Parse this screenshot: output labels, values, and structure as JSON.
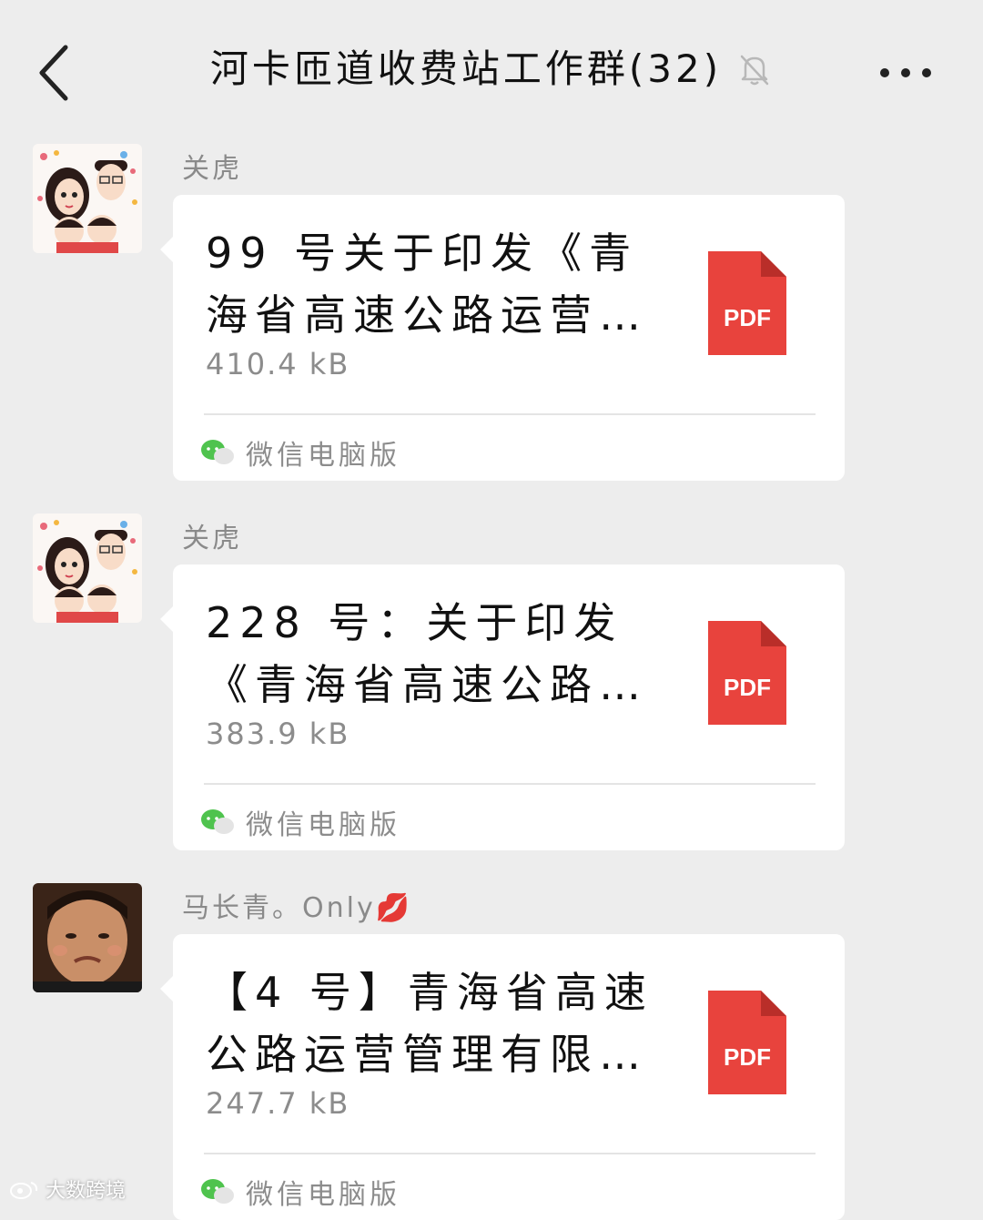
{
  "header": {
    "title": "河卡匝道收费站工作群(32)",
    "back_icon": "chevron-left-icon",
    "mute_icon": "bell-off-icon",
    "more_icon": "more-horizontal-icon"
  },
  "messages": [
    {
      "sender": "关虎",
      "file_name": "99 号关于印发《青海省高速公路运营管…",
      "file_size": "410.4 kB",
      "file_type": "PDF",
      "source": "微信电脑版"
    },
    {
      "sender": "关虎",
      "file_name": "228 号：关于印发《青海省高速公路运营…",
      "file_size": "383.9 kB",
      "file_type": "PDF",
      "source": "微信电脑版"
    },
    {
      "sender": "马长青。Only💋",
      "file_name": "【4 号】青海省高速公路运营管理有限公…",
      "file_size": "247.7 kB",
      "file_type": "PDF",
      "source": "微信电脑版"
    }
  ],
  "watermark": "大数跨境",
  "colors": {
    "background": "#ededed",
    "bubble": "#ffffff",
    "pdf_red": "#e8433d",
    "wechat_green": "#4fc34e",
    "muted_text": "#8c8c8c"
  }
}
